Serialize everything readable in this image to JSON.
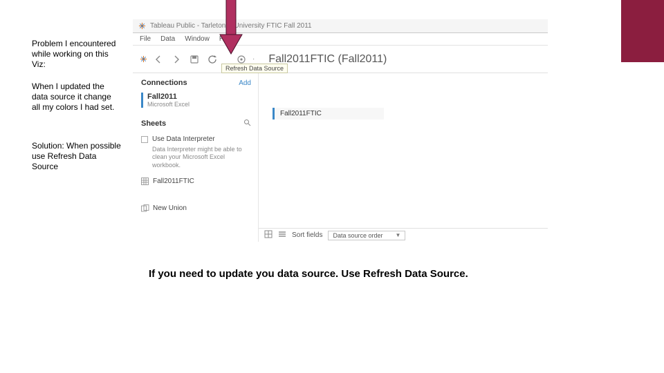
{
  "accent_color": "#8b1e3f",
  "left_notes": {
    "problem": "Problem I encountered while working on this Viz:",
    "detail": "When I updated the data source it change all my colors I had set.",
    "solution": "Solution:  When possible use Refresh Data Source"
  },
  "caption": "If you need to update you data source.  Use Refresh Data Source.",
  "tableau": {
    "window_title": "Tableau Public - Tarleton S     University FTIC Fall 2011",
    "menus": [
      "File",
      "Data",
      "Window",
      "Help"
    ],
    "refresh_tooltip": "Refresh Data Source",
    "datasource_title": "Fall2011FTIC (Fall2011)",
    "connections_label": "Connections",
    "add_label": "Add",
    "connection": {
      "name": "Fall2011",
      "subtype": "Microsoft Excel"
    },
    "sheets_label": "Sheets",
    "interpreter_label": "Use Data Interpreter",
    "interpreter_help": "Data Interpreter might be able to clean your Microsoft Excel workbook.",
    "sheet_items": [
      "Fall2011FTIC"
    ],
    "new_union_label": "New Union",
    "joined_table": "Fall2011FTIC",
    "sort_fields_label": "Sort fields",
    "sort_fields_value": "Data source order"
  }
}
